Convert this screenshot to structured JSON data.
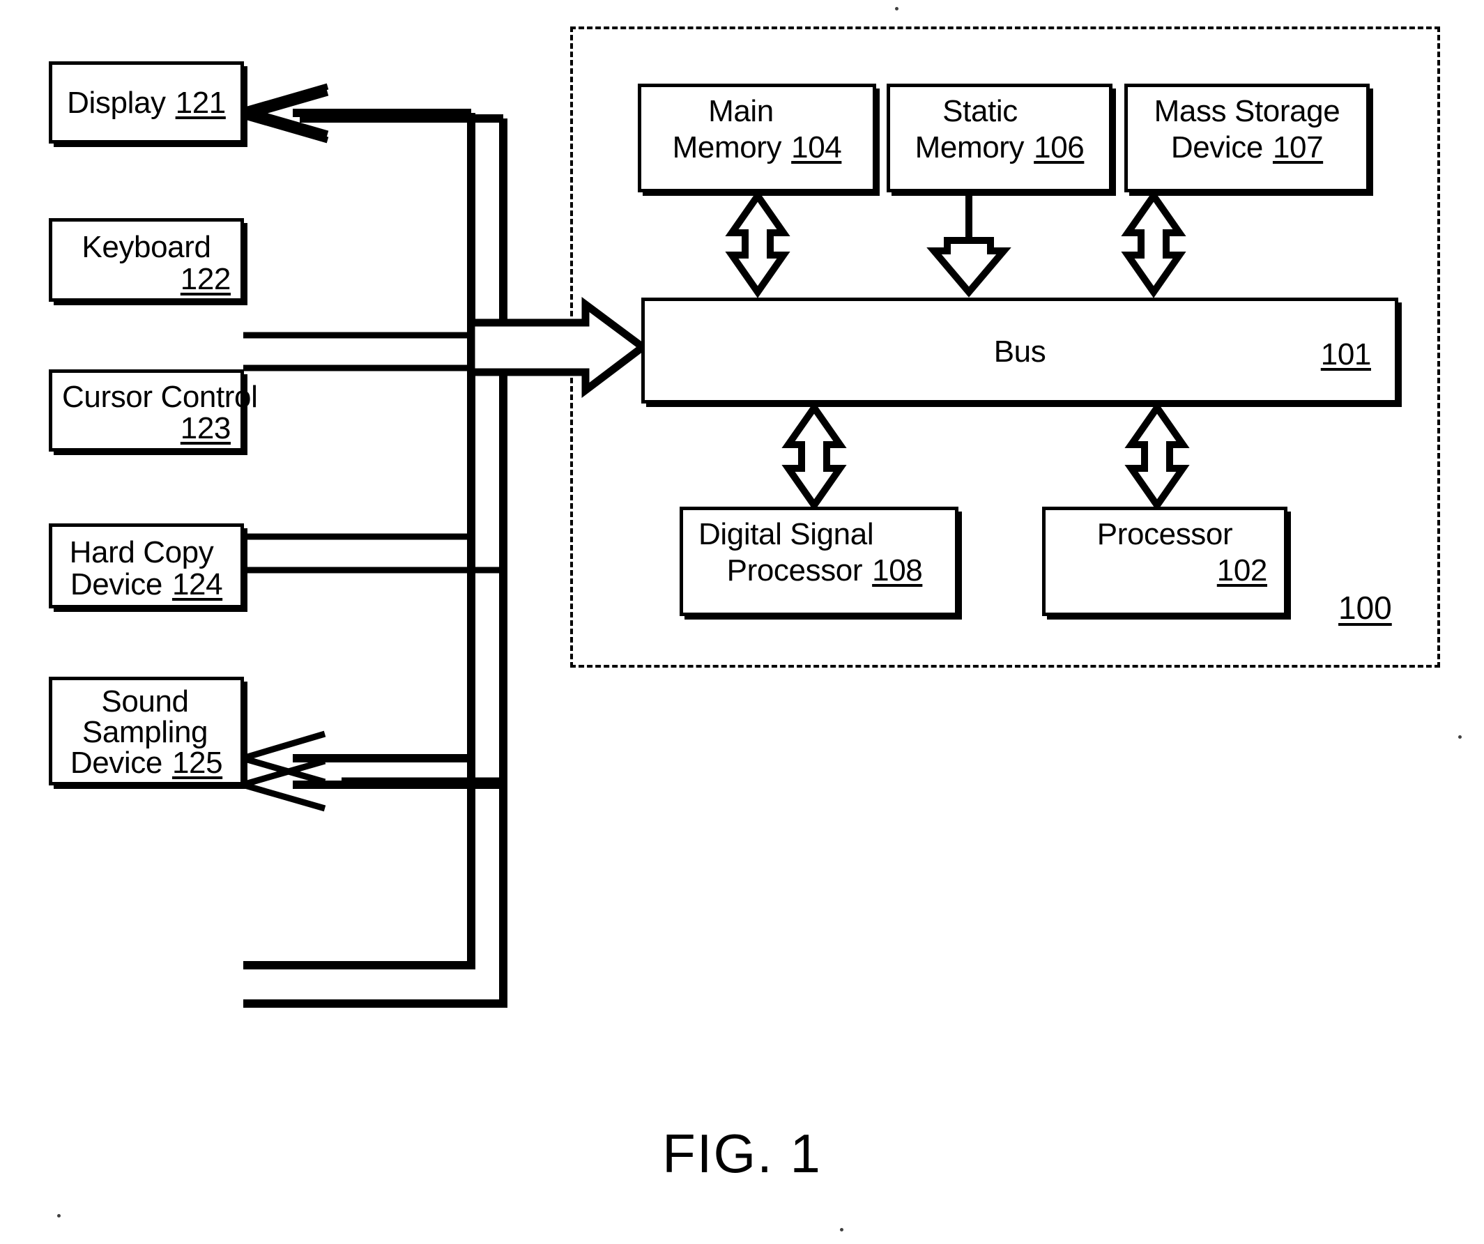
{
  "figure": {
    "caption": "FIG. 1",
    "system_ref": "100"
  },
  "peripherals": [
    {
      "id": "display",
      "lines": [
        {
          "text": "Display",
          "ref": "121",
          "align": "center"
        }
      ]
    },
    {
      "id": "keyboard",
      "lines": [
        {
          "text": "Keyboard",
          "ref": "",
          "align": "center"
        },
        {
          "text": "",
          "ref": "122",
          "align": "right"
        }
      ]
    },
    {
      "id": "cursor-control",
      "lines": [
        {
          "text": "Cursor Control",
          "ref": "",
          "align": "center"
        },
        {
          "text": "",
          "ref": "123",
          "align": "right"
        }
      ]
    },
    {
      "id": "hard-copy-device",
      "lines": [
        {
          "text": "Hard Copy",
          "ref": "",
          "align": "center"
        },
        {
          "text": "Device",
          "ref": "124",
          "align": "center"
        }
      ]
    },
    {
      "id": "sound-sampling-device",
      "lines": [
        {
          "text": "Sound",
          "ref": "",
          "align": "center"
        },
        {
          "text": "Sampling",
          "ref": "",
          "align": "center"
        },
        {
          "text": "Device",
          "ref": "125",
          "align": "center"
        }
      ]
    }
  ],
  "system_blocks": [
    {
      "id": "main-memory",
      "lines": [
        {
          "text": "Main",
          "ref": "",
          "align": "center"
        },
        {
          "text": "Memory",
          "ref": "104",
          "align": "center"
        }
      ]
    },
    {
      "id": "static-memory",
      "lines": [
        {
          "text": "Static",
          "ref": "",
          "align": "center"
        },
        {
          "text": "Memory",
          "ref": "106",
          "align": "center"
        }
      ]
    },
    {
      "id": "mass-storage-device",
      "lines": [
        {
          "text": "Mass Storage",
          "ref": "",
          "align": "center"
        },
        {
          "text": "Device",
          "ref": "107",
          "align": "center"
        }
      ]
    },
    {
      "id": "bus",
      "lines": [
        {
          "text": "Bus",
          "ref": "",
          "align": "center"
        },
        {
          "text": "",
          "ref": "101",
          "align": "right"
        }
      ]
    },
    {
      "id": "digital-signal-processor",
      "lines": [
        {
          "text": "Digital Signal",
          "ref": "",
          "align": "center"
        },
        {
          "text": "Processor",
          "ref": "108",
          "align": "center"
        }
      ]
    },
    {
      "id": "processor",
      "lines": [
        {
          "text": "Processor",
          "ref": "",
          "align": "center"
        },
        {
          "text": "",
          "ref": "102",
          "align": "right"
        }
      ]
    }
  ],
  "labels": {
    "display_name": "Display",
    "display_ref": "121",
    "keyboard_name": "Keyboard",
    "keyboard_ref": "122",
    "cursor_name": "Cursor Control",
    "cursor_ref": "123",
    "hardcopy_name_1": "Hard Copy",
    "hardcopy_name_2": "Device",
    "hardcopy_ref": "124",
    "sound_name_1": "Sound",
    "sound_name_2": "Sampling",
    "sound_name_3": "Device",
    "sound_ref": "125",
    "mainmem_name_1": "Main",
    "mainmem_name_2": "Memory",
    "mainmem_ref": "104",
    "staticmem_name_1": "Static",
    "staticmem_name_2": "Memory",
    "staticmem_ref": "106",
    "massstorage_name_1": "Mass Storage",
    "massstorage_name_2": "Device",
    "massstorage_ref": "107",
    "bus_name": "Bus",
    "bus_ref": "101",
    "dsp_name_1": "Digital Signal",
    "dsp_name_2": "Processor",
    "dsp_ref": "108",
    "processor_name": "Processor",
    "processor_ref": "102"
  }
}
